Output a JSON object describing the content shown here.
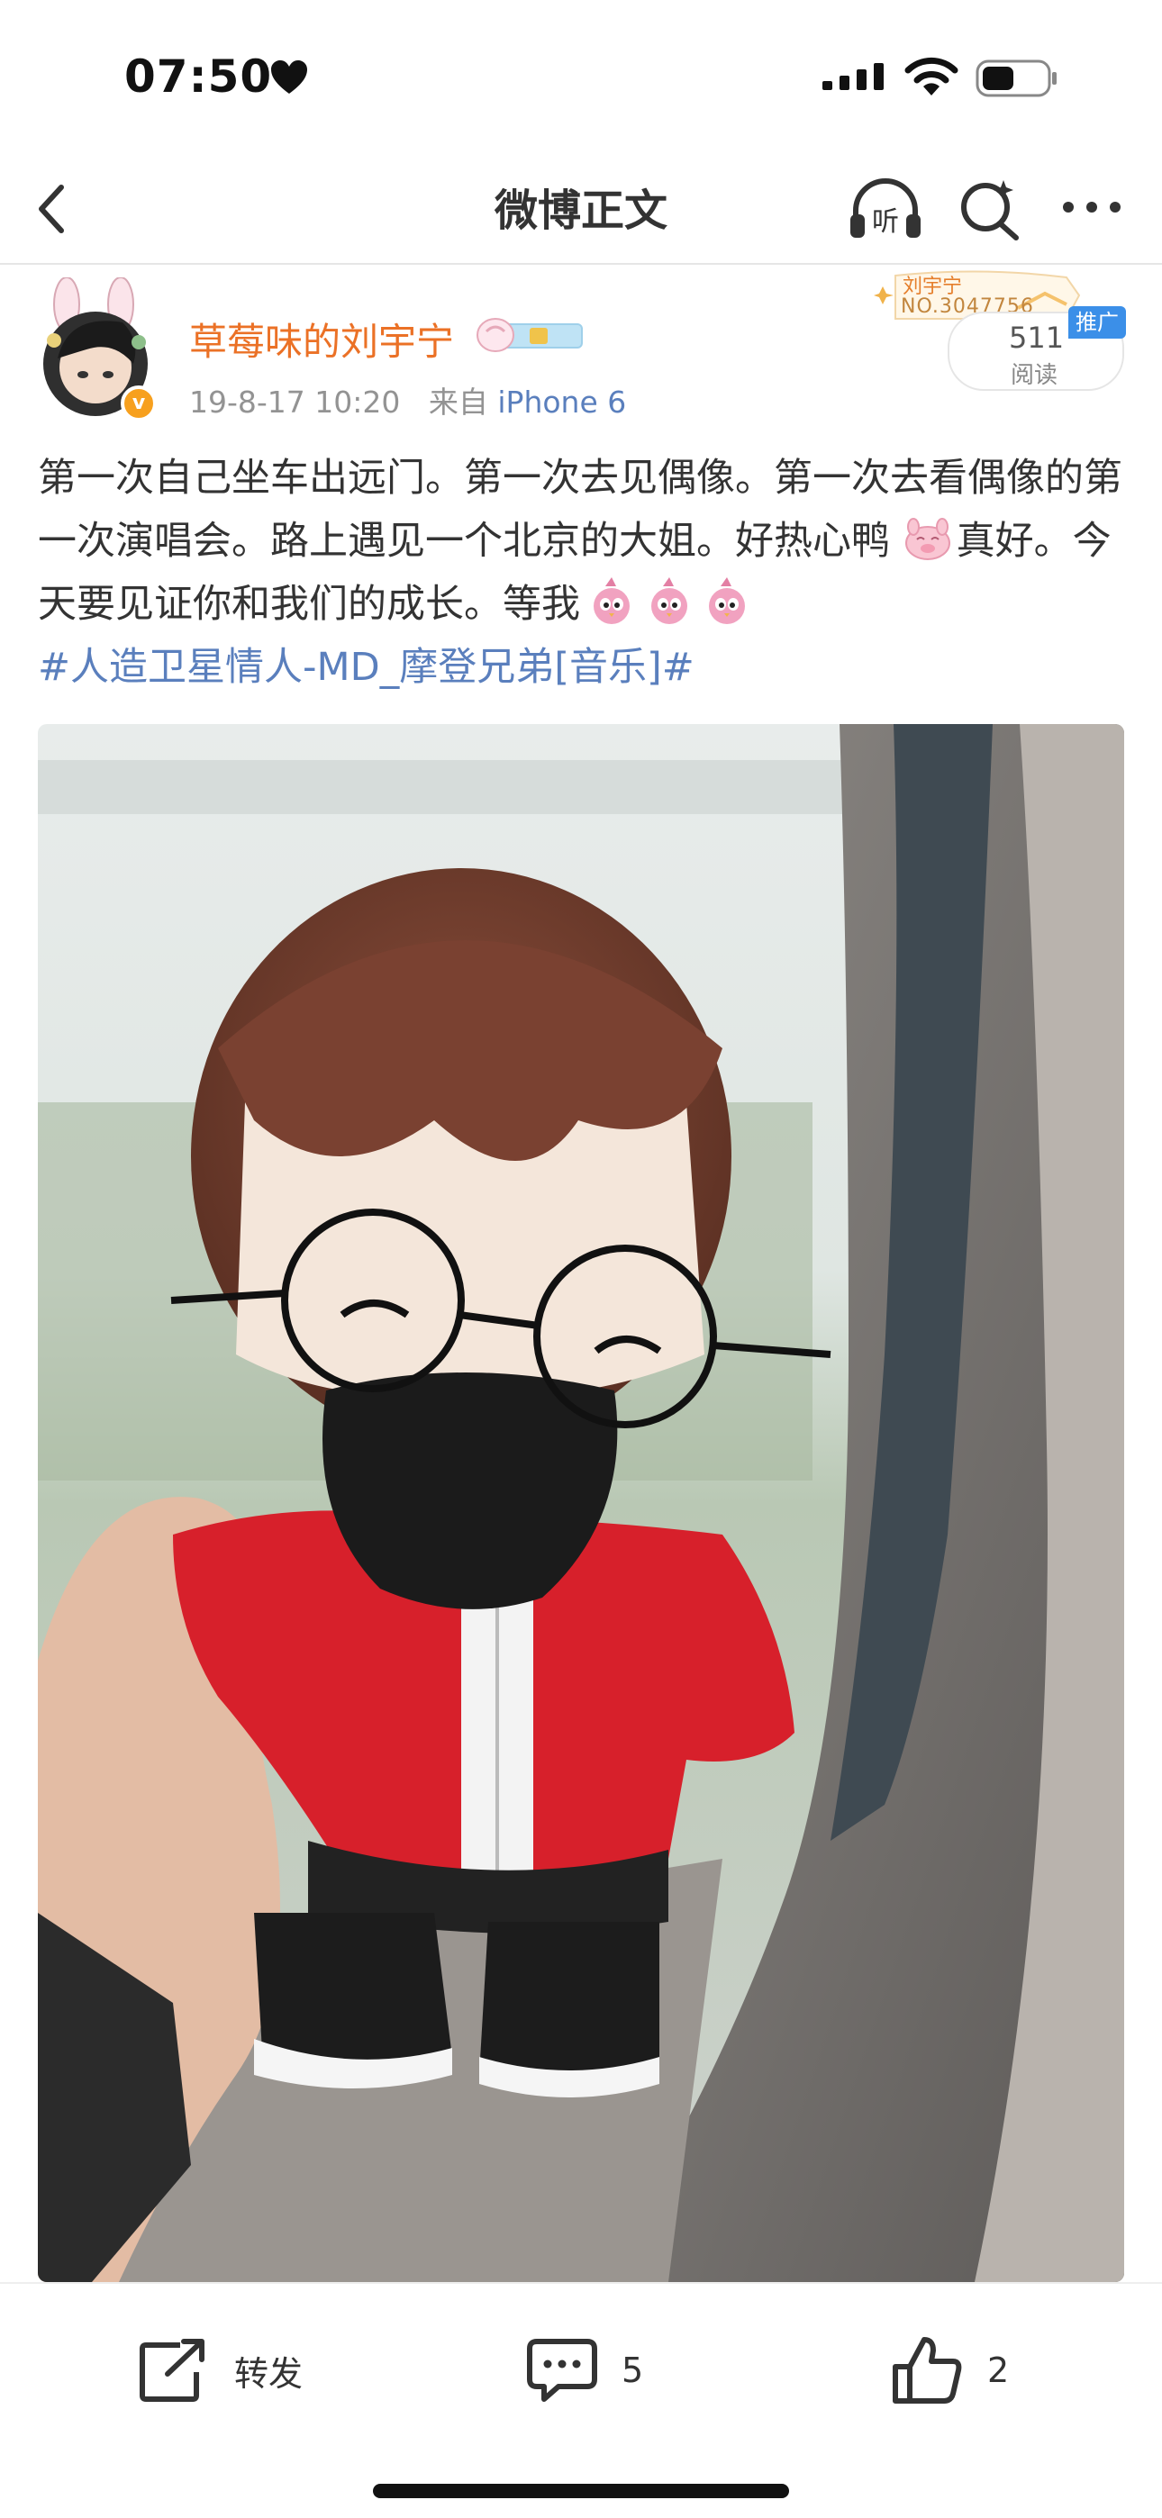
{
  "status_bar": {
    "time": "07:50",
    "icons": [
      "heart-icon",
      "signal-icon",
      "wifi-icon",
      "battery-icon"
    ]
  },
  "nav": {
    "title": "微博正文",
    "listen_label": "听",
    "icons": [
      "back-icon",
      "listen-icon",
      "search-icon",
      "more-icon"
    ]
  },
  "post": {
    "username": "草莓味的刘宇宁",
    "date": "19-8-17 10:20",
    "source_prefix": "来自",
    "source": "iPhone 6",
    "promo_line1": "刘宇宁",
    "promo_line2": "NO.3047756",
    "read_count": "511",
    "read_label": "阅读",
    "ad_label": "推广",
    "text_part1": "第一次自己坐车出远门。第一次去见偶像。第一次去看偶像的第一次演唱会。路上遇见一个北京的大姐。好热心鸭",
    "text_part2": "真好。今天要见证你和我们的成长。等我",
    "hashtag": "#人造卫星情人-MD_摩登兄弟[音乐]#"
  },
  "actions": {
    "repost_label": "转发",
    "comment_count": "5",
    "like_count": "2"
  },
  "colors": {
    "username": "#eb7126",
    "link": "#5a7fbd",
    "meta": "#939393",
    "ad_blue": "#3b8fe8"
  }
}
